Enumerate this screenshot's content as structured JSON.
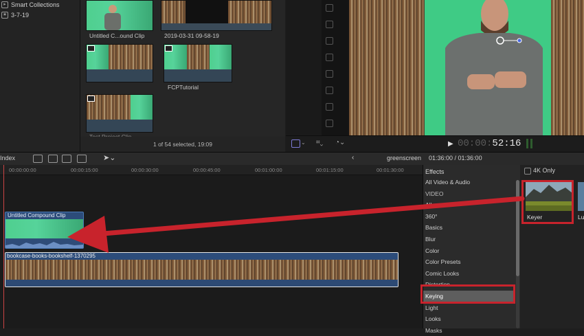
{
  "sidebar": {
    "items": [
      {
        "label": "Smart Collections",
        "icon": "folder-icon"
      },
      {
        "label": "3-7-19",
        "icon": "star-event-icon"
      }
    ]
  },
  "browser": {
    "clips": [
      {
        "label": "Untitled C...ound Clip"
      },
      {
        "label": "2019-03-31 09-58-19"
      },
      {
        "label": "FCPTutorial"
      },
      {
        "label": "Test Project Clip"
      }
    ],
    "status": "1 of 54 selected, 19:09"
  },
  "viewer": {
    "timecode_dim": "00:00:",
    "timecode_bright": "52:16"
  },
  "timeline_toolbar": {
    "index_label": "Index",
    "project_name": "greenscreen",
    "duration": "01:36:00 / 01:36:00"
  },
  "timeline": {
    "ruler": [
      "00:00:00:00",
      "00:00:15:00",
      "00:00:30:00",
      "00:00:45:00",
      "00:01:00:00",
      "00:01:15:00",
      "00:01:30:00"
    ],
    "compound_clip_label": "Untitled Compound Clip",
    "main_clip_label": "bookcase-books-bookshelf-1370295"
  },
  "effects": {
    "header": "Effects",
    "four_k_label": "4K Only",
    "categories": [
      {
        "label": "All Video & Audio",
        "kind": "item"
      },
      {
        "label": "VIDEO",
        "kind": "heading"
      },
      {
        "label": "All",
        "kind": "item"
      },
      {
        "label": "360°",
        "kind": "item"
      },
      {
        "label": "Basics",
        "kind": "item"
      },
      {
        "label": "Blur",
        "kind": "item"
      },
      {
        "label": "Color",
        "kind": "item"
      },
      {
        "label": "Color Presets",
        "kind": "item"
      },
      {
        "label": "Comic Looks",
        "kind": "item"
      },
      {
        "label": "Distortion",
        "kind": "item"
      },
      {
        "label": "Keying",
        "kind": "selected"
      },
      {
        "label": "Light",
        "kind": "item"
      },
      {
        "label": "Looks",
        "kind": "item"
      },
      {
        "label": "Masks",
        "kind": "item"
      }
    ],
    "keyer_label": "Keyer",
    "next_label": "Lu"
  },
  "colors": {
    "highlight_red": "#c8232c",
    "clip_blue": "#2c4c7a",
    "green_screen": "#3fcb85"
  }
}
